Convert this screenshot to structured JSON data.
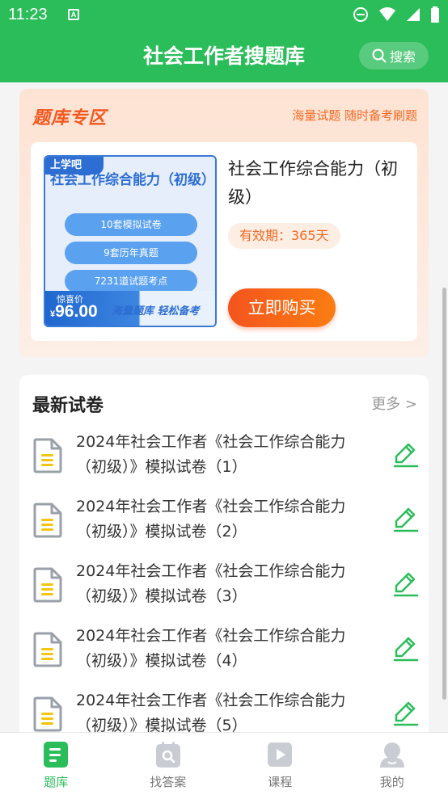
{
  "status": {
    "time": "11:23",
    "app_badge": "A"
  },
  "header": {
    "title": "社会工作者搜题库",
    "search_label": "搜索"
  },
  "promo": {
    "section_title": "题库专区",
    "slogan": "海量试题 随时备考刷题",
    "cover": {
      "brand": "上学吧",
      "title": "社会工作综合能力（初级）",
      "features": [
        "10套模拟试卷",
        "9套历年真题",
        "7231道试题考点"
      ],
      "price_label": "惊喜价",
      "currency": "¥",
      "price": "96.00",
      "slogan": "海量题库  轻松备考"
    },
    "product_name": "社会工作综合能力（初级）",
    "validity": "有效期：365天",
    "buy_label": "立即购买"
  },
  "papers": {
    "title": "最新试卷",
    "more_label": "更多 >",
    "items": [
      "2024年社会工作者《社会工作综合能力（初级）》模拟试卷（1）",
      "2024年社会工作者《社会工作综合能力（初级）》模拟试卷（2）",
      "2024年社会工作者《社会工作综合能力（初级）》模拟试卷（3）",
      "2024年社会工作者《社会工作综合能力（初级）》模拟试卷（4）",
      "2024年社会工作者《社会工作综合能力（初级）》模拟试卷（5）"
    ]
  },
  "nav": {
    "items": [
      {
        "label": "题库",
        "icon": "question-bank-icon",
        "active": true
      },
      {
        "label": "找答案",
        "icon": "find-answer-icon",
        "active": false
      },
      {
        "label": "课程",
        "icon": "course-play-icon",
        "active": false
      },
      {
        "label": "我的",
        "icon": "profile-icon",
        "active": false
      }
    ]
  },
  "colors": {
    "brand_green": "#2bbd5a",
    "accent_orange": "#f26a26",
    "cover_blue": "#2d6ed3"
  }
}
